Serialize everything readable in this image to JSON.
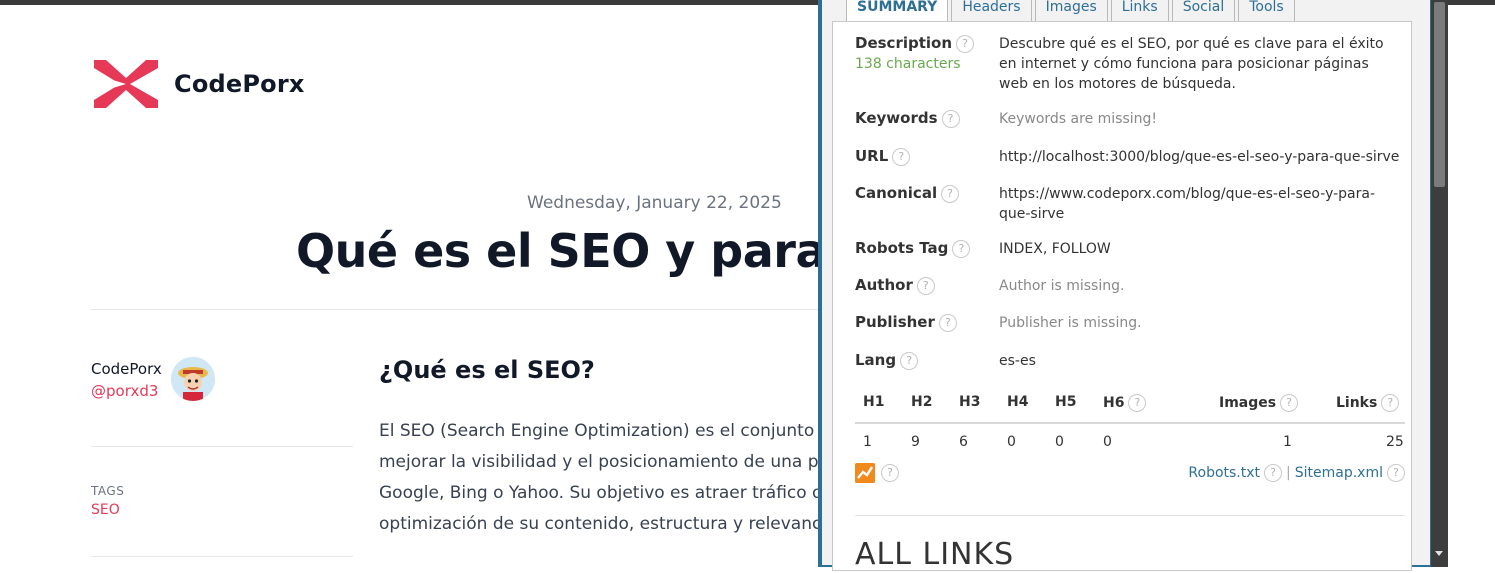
{
  "blog": {
    "brand": "CodePorx",
    "date": "Wednesday, January 22, 2025",
    "title": "Qué es el SEO y para q",
    "author_name": "CodePorx",
    "author_handle": "@porxd3",
    "tags_label": "TAGS",
    "tag": "SEO",
    "section_heading": "¿Qué es el SEO?",
    "paragraph_lines": [
      "El SEO (Search Engine Optimization) es el conjunto d",
      "mejorar la visibilidad y el posicionamiento de una pá",
      "Google, Bing o Yahoo. Su objetivo es atraer tráfico o",
      "optimización de su contenido, estructura y relevanc"
    ],
    "colors": {
      "accent": "#e63958",
      "text": "#111827"
    }
  },
  "panel": {
    "tabs": [
      "SUMMARY",
      "Headers",
      "Images",
      "Links",
      "Social",
      "Tools"
    ],
    "help_glyph": "?",
    "description": {
      "label": "Description",
      "count": "138 characters",
      "value": "Descubre qué es el SEO, por qué es clave para el éxito en internet y cómo funciona para posicionar páginas web en los motores de búsqueda."
    },
    "keywords": {
      "label": "Keywords",
      "value": "Keywords are missing!"
    },
    "url": {
      "label": "URL",
      "value": "http://localhost:3000/blog/que-es-el-seo-y-para-que-sirve"
    },
    "canonical": {
      "label": "Canonical",
      "value": "https://www.codeporx.com/blog/que-es-el-seo-y-para-que-sirve"
    },
    "robots": {
      "label": "Robots Tag",
      "value": "INDEX, FOLLOW"
    },
    "author": {
      "label": "Author",
      "value": "Author is missing."
    },
    "publisher": {
      "label": "Publisher",
      "value": "Publisher is missing."
    },
    "lang": {
      "label": "Lang",
      "value": "es-es"
    },
    "headings": {
      "h1": {
        "label": "H1",
        "value": "1"
      },
      "h2": {
        "label": "H2",
        "value": "9"
      },
      "h3": {
        "label": "H3",
        "value": "6"
      },
      "h4": {
        "label": "H4",
        "value": "0"
      },
      "h5": {
        "label": "H5",
        "value": "0"
      },
      "h6": {
        "label": "H6",
        "value": "0"
      },
      "images": {
        "label": "Images",
        "value": "1"
      },
      "links": {
        "label": "Links",
        "value": "25"
      }
    },
    "robots_txt": "Robots.txt",
    "sitemap": "Sitemap.xml",
    "separator": "|",
    "all_links_heading": "ALL LINKS",
    "colors": {
      "frame": "#2e6f96",
      "ok": "#6aa84f",
      "trend": "#f08a1c"
    }
  }
}
